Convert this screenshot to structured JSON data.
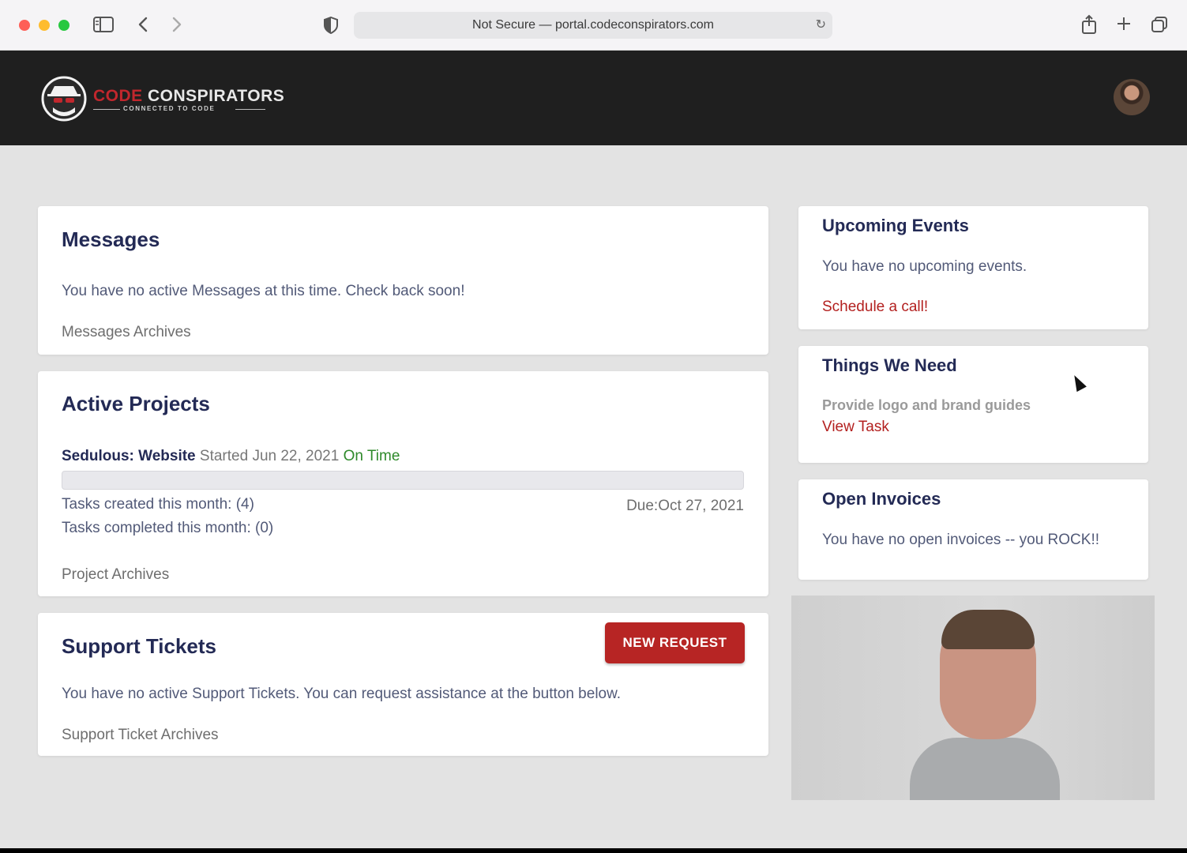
{
  "browser": {
    "url": "Not Secure — portal.codeconspirators.com"
  },
  "header": {
    "logo_word1": "CODE",
    "logo_word2": "CONSPIRATORS",
    "logo_tagline": "CONNECTED TO CODE"
  },
  "messages": {
    "title": "Messages",
    "empty_text": "You have no active Messages at this time. Check back soon!",
    "archives_link": "Messages Archives"
  },
  "projects": {
    "title": "Active Projects",
    "project_name": "Sedulous: Website",
    "started": "Started Jun 22, 2021",
    "status": "On Time",
    "progress": 0,
    "tasks_created": "Tasks created this month: (4)",
    "tasks_completed": "Tasks completed this month: (0)",
    "due": "Due:Oct 27, 2021",
    "archives_link": "Project Archives"
  },
  "support": {
    "title": "Support Tickets",
    "new_request_label": "NEW REQUEST",
    "empty_text": "You have no active Support Tickets. You can request assistance at the button below.",
    "archives_link": "Support Ticket Archives"
  },
  "events": {
    "title": "Upcoming Events",
    "empty_text": "You have no upcoming events.",
    "cta": "Schedule a call!"
  },
  "needs": {
    "title": "Things We Need",
    "item": "Provide logo and brand guides",
    "cta": "View Task"
  },
  "invoices": {
    "title": "Open Invoices",
    "empty_text": "You have no open invoices -- you ROCK!!"
  },
  "colors": {
    "accent_red": "#b72524",
    "navy": "#232a55",
    "status_green": "#2f8a2b",
    "header_bg": "#1f1f1f",
    "page_bg": "#e3e3e3"
  }
}
